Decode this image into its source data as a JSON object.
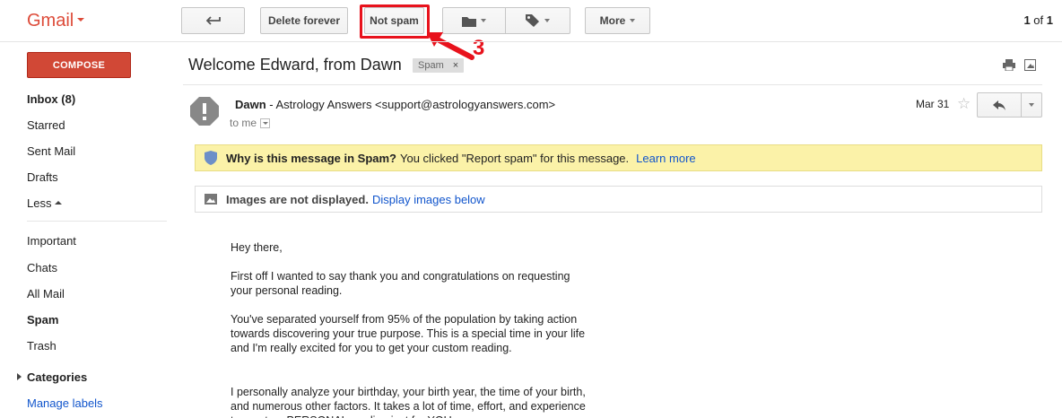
{
  "app": {
    "logo": "Gmail"
  },
  "toolbar": {
    "delete_forever": "Delete forever",
    "not_spam": "Not spam",
    "more": "More",
    "back_icon": "archive-back-icon",
    "folder_icon": "folder-icon",
    "label_icon": "label-tag-icon"
  },
  "annotation": {
    "step": "3",
    "color": "#e8121c"
  },
  "pager": {
    "current": "1",
    "of_label": "of",
    "total": "1"
  },
  "sidebar": {
    "compose": "COMPOSE",
    "items": [
      {
        "label": "Inbox (8)"
      },
      {
        "label": "Starred"
      },
      {
        "label": "Sent Mail"
      },
      {
        "label": "Drafts"
      },
      {
        "label": "Less"
      },
      {
        "label": "Important"
      },
      {
        "label": "Chats"
      },
      {
        "label": "All Mail"
      },
      {
        "label": "Spam"
      },
      {
        "label": "Trash"
      },
      {
        "label": "Categories"
      },
      {
        "label": "Manage labels"
      }
    ]
  },
  "message": {
    "subject": "Welcome Edward, from Dawn",
    "chip": "Spam",
    "chip_close": "×",
    "sender_name": "Dawn",
    "sender_rest": " - Astrology Answers <support@astrologyanswers.com>",
    "to": "to me",
    "date": "Mar 31",
    "spam_banner": {
      "title": "Why is this message in Spam?",
      "text": "You clicked \"Report spam\" for this message.",
      "link": "Learn more"
    },
    "images_banner": {
      "title": "Images are not displayed.",
      "link": "Display images below"
    },
    "body": [
      "Hey there,",
      "First off I wanted to say thank you and congratulations on requesting your personal reading.",
      "You've separated yourself from 95% of the population by taking action towards discovering your true purpose. This is a special time in your life and I'm really excited for you to get your custom reading.",
      "I personally analyze your birthday, your birth year, the time of your birth, and numerous other factors. It takes a lot of time, effort, and experience to create a PERSONAL reading just for YOU."
    ]
  },
  "colors": {
    "brand": "#dd4b39",
    "compose": "#d14836",
    "link": "#1155cc",
    "spam_banner_bg": "#fbf2a8"
  }
}
